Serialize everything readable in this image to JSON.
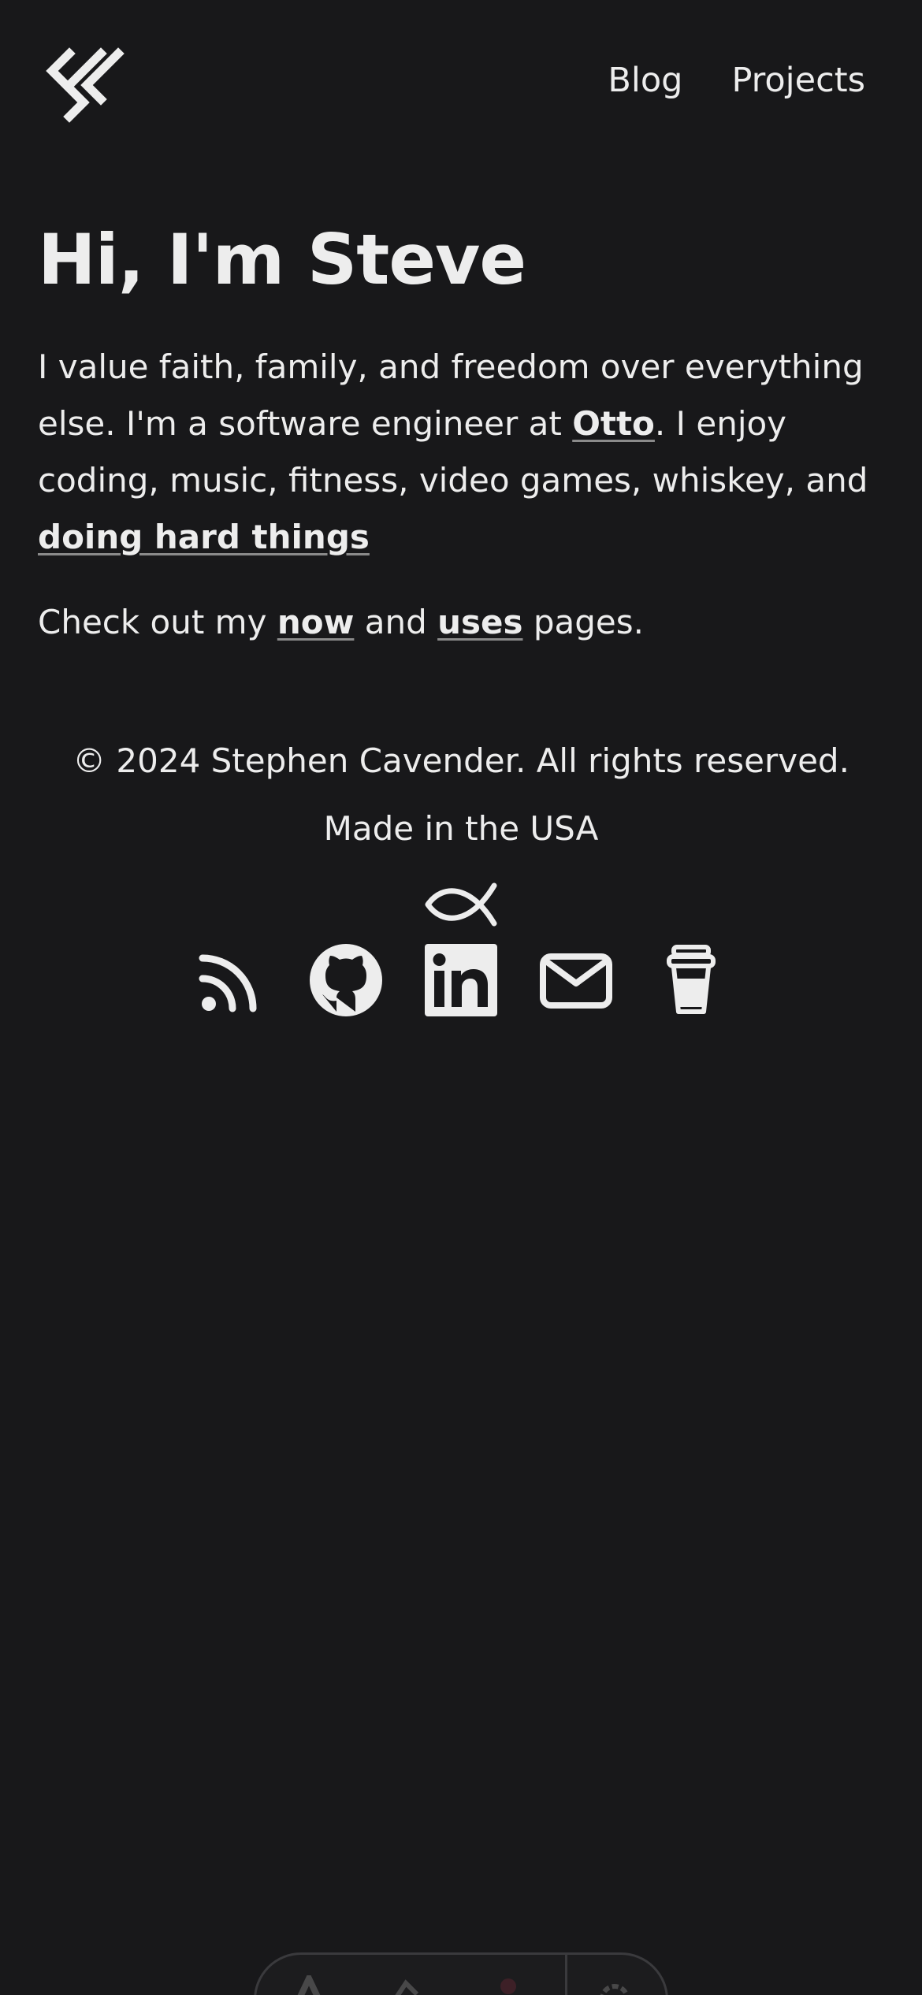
{
  "header": {
    "logo_icon": "sc-monogram-logo",
    "nav": [
      {
        "label": "Blog"
      },
      {
        "label": "Projects"
      }
    ]
  },
  "main": {
    "title": "Hi, I'm Steve",
    "intro": {
      "part1": "I value faith, family, and freedom over everything else. I'm a software engineer at ",
      "link_otto": "Otto",
      "part2": ". I enjoy coding, music, fitness, video games, whiskey, and ",
      "link_hard": "doing hard things"
    },
    "pages": {
      "prefix": "Check out my ",
      "link_now": "now",
      "middle": " and ",
      "link_uses": "uses",
      "suffix": " pages."
    }
  },
  "footer": {
    "copyright": "© 2024 Stephen Cavender. All rights reserved.",
    "made_in": "Made in the USA",
    "fish_icon": "ichthys-fish-icon",
    "socials": [
      {
        "icon": "rss-icon"
      },
      {
        "icon": "github-icon"
      },
      {
        "icon": "linkedin-icon"
      },
      {
        "icon": "mail-icon"
      },
      {
        "icon": "coffee-cup-icon"
      }
    ]
  },
  "colors": {
    "background": "#18181a",
    "text": "#ededed",
    "underline": "#8a8a8a"
  }
}
